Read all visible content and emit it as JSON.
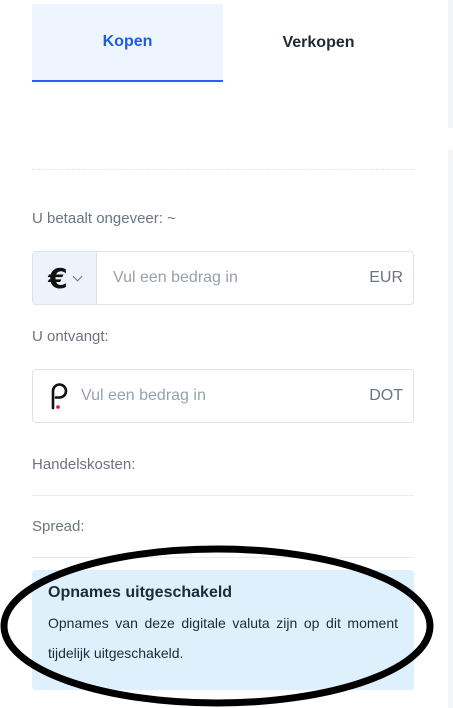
{
  "tabs": [
    {
      "label": "Kopen",
      "active": true
    },
    {
      "label": "Verkopen",
      "active": false
    }
  ],
  "pay": {
    "label": "U betaalt ongeveer: ~",
    "currency_symbol": "€",
    "placeholder": "Vul een bedrag in",
    "unit": "EUR"
  },
  "receive": {
    "label": "U ontvangt:",
    "placeholder": "Vul een bedrag in",
    "unit": "DOT",
    "icon": "polkadot-icon"
  },
  "fees": {
    "trading_label": "Handelskosten:",
    "spread_label": "Spread:"
  },
  "notice": {
    "title": "Opnames uitgeschakeld",
    "text": "Opnames van deze digitale valuta zijn op dit moment tijdelijk uitgeschakeld."
  },
  "colors": {
    "accent": "#2563eb",
    "notice_bg": "#dff0fd",
    "annotation": "#000000"
  }
}
